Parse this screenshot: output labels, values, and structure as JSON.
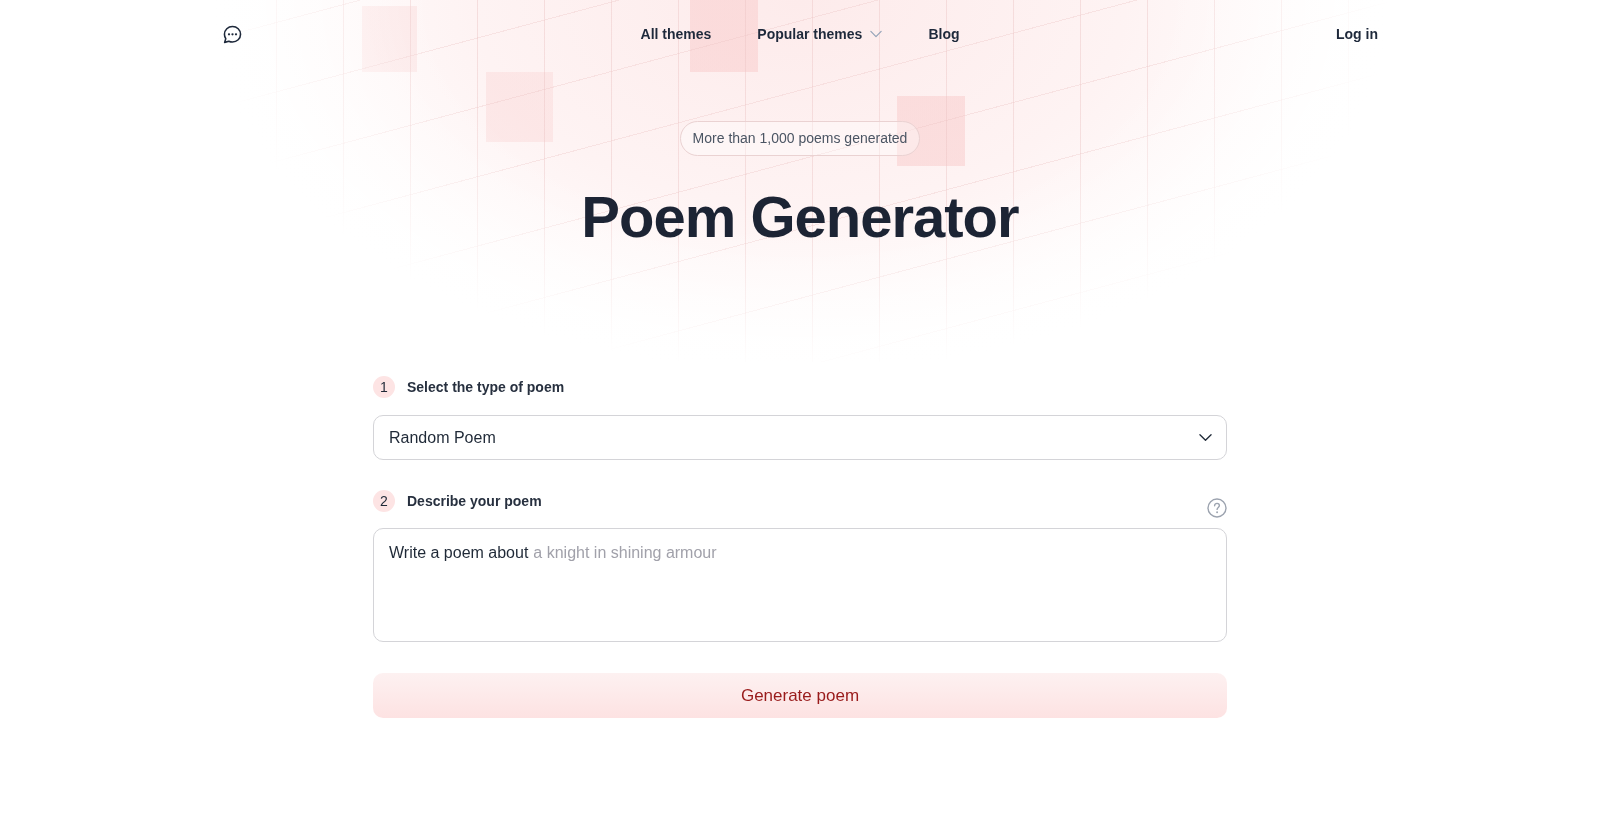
{
  "nav": {
    "links": [
      {
        "label": "All themes",
        "kind": "link"
      },
      {
        "label": "Popular themes",
        "kind": "dropdown"
      },
      {
        "label": "Blog",
        "kind": "link"
      }
    ],
    "login": "Log in"
  },
  "hero": {
    "badge": "More than 1,000 poems generated",
    "title": "Poem Generator"
  },
  "steps": [
    {
      "number": "1",
      "label": "Select the type of poem",
      "kind": "select",
      "value": "Random Poem",
      "help": false
    },
    {
      "number": "2",
      "label": "Describe your poem",
      "kind": "textarea",
      "prefix": "Write a poem about",
      "placeholder": "a knight in shining armour",
      "help": true
    }
  ],
  "submit": "Generate poem"
}
